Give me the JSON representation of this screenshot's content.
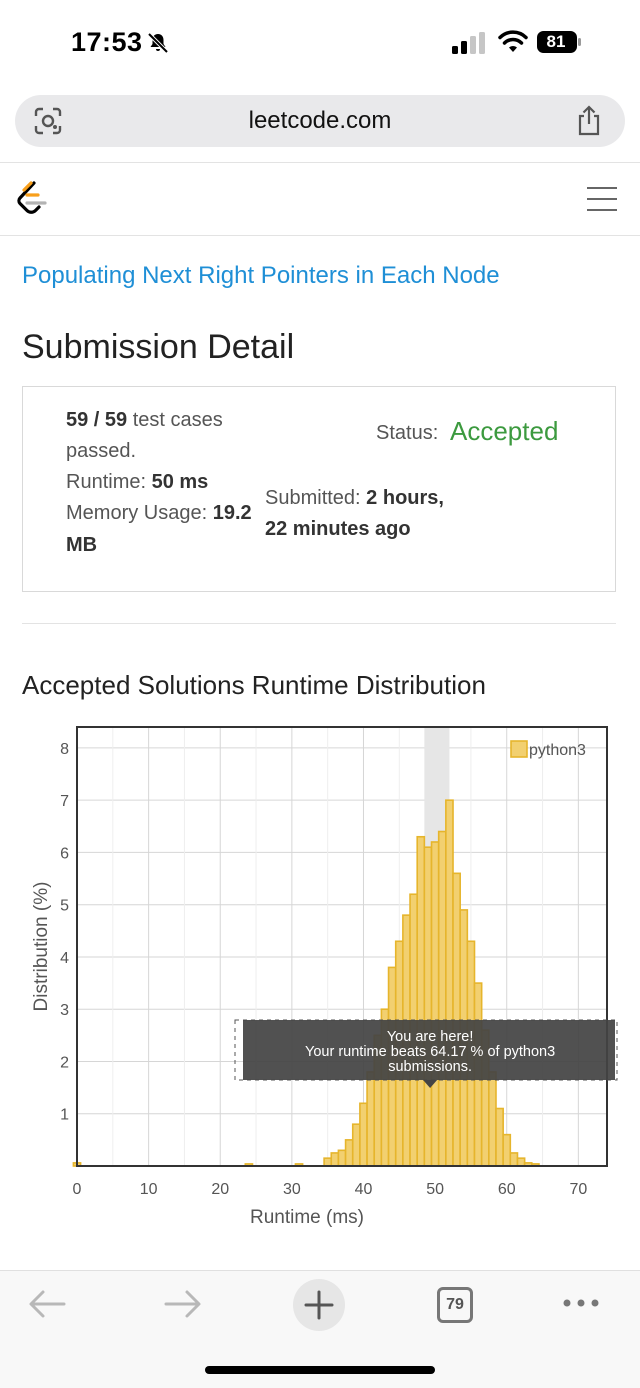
{
  "status_bar": {
    "time": "17:53",
    "battery": "81",
    "icons": [
      "bell-slash-icon",
      "cellular-signal-icon",
      "wifi-icon",
      "battery-icon"
    ]
  },
  "browser": {
    "url": "leetcode.com",
    "tab_count": "79",
    "icons": [
      "visual-lookup-icon",
      "share-icon",
      "back-icon",
      "forward-icon",
      "new-tab-icon",
      "tabs-icon",
      "more-icon"
    ]
  },
  "header": {
    "logo": "leetcode-logo",
    "menu": "hamburger-menu-icon"
  },
  "problem": {
    "title": "Populating Next Right Pointers in Each Node"
  },
  "page": {
    "title": "Submission Detail"
  },
  "details": {
    "test_cases_value": "59 / 59",
    "test_cases_suffix": "test cases",
    "test_cases_passed": "passed.",
    "runtime_label": "Runtime:",
    "runtime_value": "50 ms",
    "memory_label": "Memory Usage:",
    "memory_value": "19.2",
    "memory_unit": "MB",
    "submitted_label": "Submitted:",
    "submitted_value_1": "2 hours,",
    "submitted_value_2": "22 minutes ago",
    "status_label": "Status:",
    "status_value": "Accepted"
  },
  "distribution": {
    "title": "Accepted Solutions Runtime Distribution",
    "tooltip_line1": "You are here!",
    "tooltip_line2": "Your runtime beats 64.17 % of python3",
    "tooltip_line3": "submissions."
  },
  "colors": {
    "link": "#1f8fd6",
    "accepted": "#3c9a3f",
    "bar_fill": "#f2d070",
    "bar_stroke": "#e6b52c",
    "tooltip_bg": "#444444",
    "highlight_band": "#e6e6e6"
  },
  "chart_data": {
    "type": "bar",
    "xlabel": "Runtime (ms)",
    "ylabel": "Distribution (%)",
    "xlim": [
      0,
      74
    ],
    "ylim": [
      0,
      8.4
    ],
    "xticks": [
      0,
      10,
      20,
      30,
      40,
      50,
      60,
      70
    ],
    "yticks": [
      1,
      2,
      3,
      4,
      5,
      6,
      7,
      8
    ],
    "grid": true,
    "legend": "top-right",
    "bar_width": 1,
    "highlight_range": [
      48.5,
      52
    ],
    "series": [
      {
        "name": "python3",
        "x": [
          0,
          24,
          31,
          35,
          36,
          37,
          38,
          39,
          40,
          41,
          42,
          43,
          44,
          45,
          46,
          47,
          48,
          49,
          50,
          51,
          52,
          53,
          54,
          55,
          56,
          57,
          58,
          59,
          60,
          61,
          62,
          63,
          64
        ],
        "values": [
          0.06,
          0.04,
          0.04,
          0.15,
          0.25,
          0.3,
          0.5,
          0.8,
          1.2,
          1.8,
          2.5,
          3.0,
          3.8,
          4.3,
          4.8,
          5.2,
          6.3,
          6.1,
          6.2,
          6.4,
          7.0,
          5.6,
          4.9,
          4.3,
          3.5,
          2.6,
          1.8,
          1.1,
          0.6,
          0.25,
          0.15,
          0.06,
          0.04
        ]
      }
    ]
  }
}
